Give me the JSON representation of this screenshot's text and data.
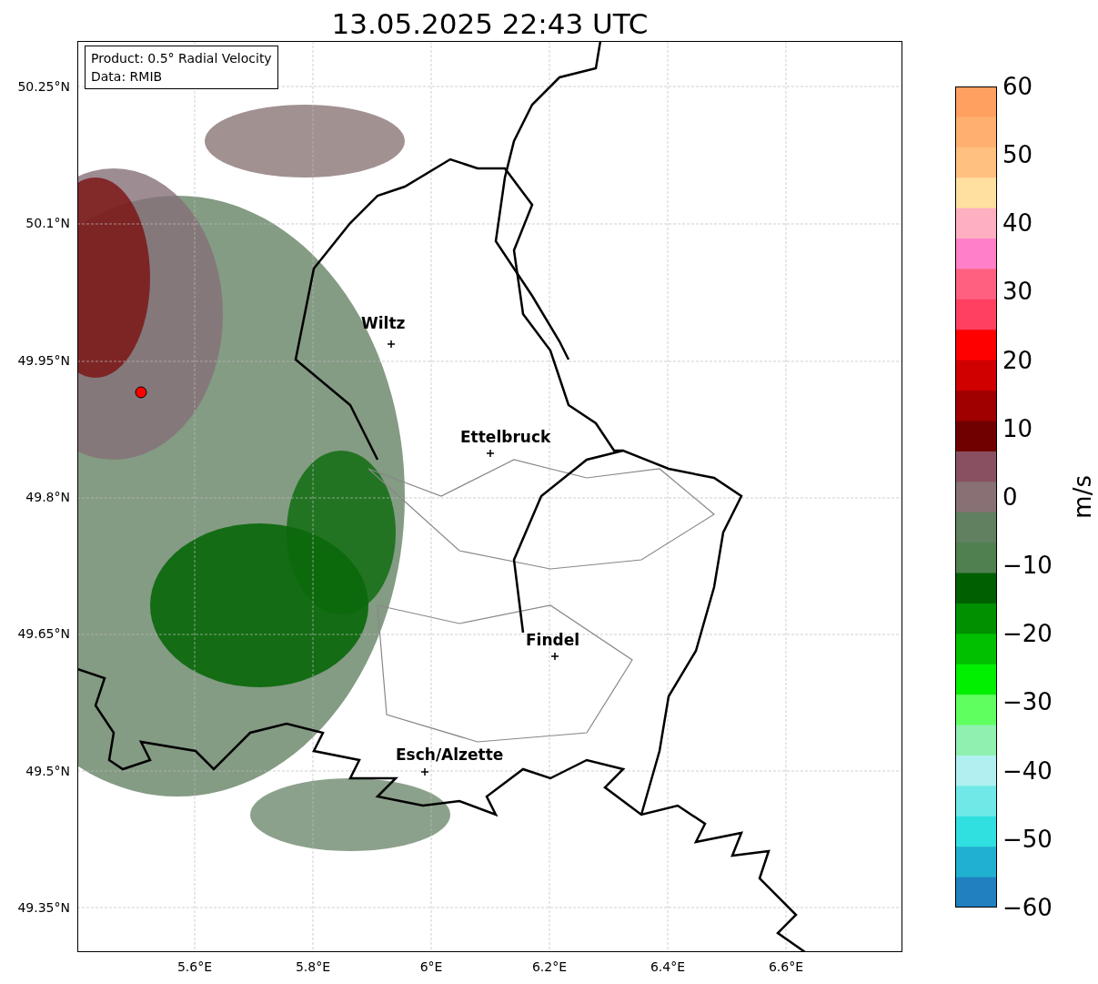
{
  "title": "13.05.2025 22:43 UTC",
  "legend": {
    "lines": [
      "Product: 0.5° Radial Velocity",
      "Data: RMIB"
    ]
  },
  "map": {
    "places": [
      {
        "name": "Wiltz"
      },
      {
        "name": "Ettelbruck"
      },
      {
        "name": "Findel"
      },
      {
        "name": "Esch/Alzette"
      }
    ]
  },
  "y_ticks": [
    "50.25°N",
    "50.1°N",
    "49.95°N",
    "49.8°N",
    "49.65°N",
    "49.5°N",
    "49.35°N"
  ],
  "x_ticks": [
    "5.6°E",
    "5.8°E",
    "6°E",
    "6.2°E",
    "6.4°E",
    "6.6°E"
  ],
  "colorbar": {
    "label": "m/s",
    "ticks": [
      "60",
      "50",
      "40",
      "30",
      "20",
      "10",
      "0",
      "−10",
      "−20",
      "−30",
      "−40",
      "−50",
      "−60"
    ]
  }
}
